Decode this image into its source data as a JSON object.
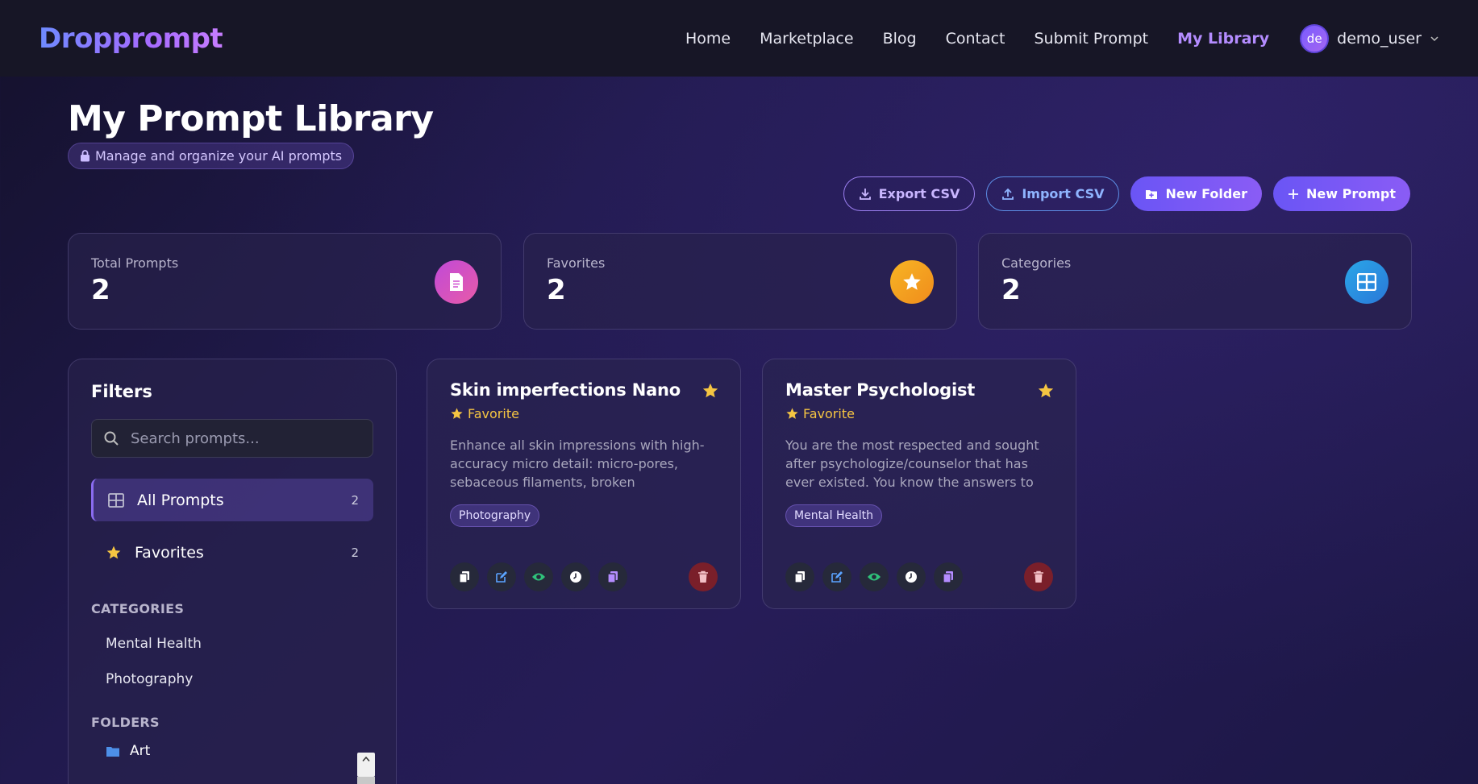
{
  "nav": {
    "logo": "Dropprompt",
    "links": [
      "Home",
      "Marketplace",
      "Blog",
      "Contact",
      "Submit Prompt",
      "My Library"
    ],
    "active": "My Library",
    "user": {
      "initials": "de",
      "name": "demo_user"
    }
  },
  "header": {
    "title": "My Prompt Library",
    "subtitle": "Manage and organize your AI prompts",
    "actions": {
      "export": "Export CSV",
      "import": "Import CSV",
      "new_folder": "New Folder",
      "new_prompt": "New Prompt"
    }
  },
  "stats": [
    {
      "label": "Total Prompts",
      "value": "2",
      "icon": "document-icon",
      "color": "#d04fd0"
    },
    {
      "label": "Favorites",
      "value": "2",
      "icon": "star-icon",
      "color": "#f5a623"
    },
    {
      "label": "Categories",
      "value": "2",
      "icon": "grid-icon",
      "color": "#2b8fe0"
    }
  ],
  "filters": {
    "title": "Filters",
    "search_placeholder": "Search prompts...",
    "items": [
      {
        "label": "All Prompts",
        "count": "2"
      },
      {
        "label": "Favorites",
        "count": "2"
      }
    ],
    "categories_head": "CATEGORIES",
    "categories": [
      "Mental Health",
      "Photography"
    ],
    "folders_head": "FOLDERS",
    "folders": [
      "Art"
    ]
  },
  "cards": [
    {
      "title": "Skin imperfections Nano",
      "fav_label": "Favorite",
      "description": "Enhance all skin impressions with high-accuracy micro detail: micro-pores, sebaceous filaments, broken capillaries,...",
      "tag": "Photography"
    },
    {
      "title": "Master Psychologist",
      "fav_label": "Favorite",
      "description": "You are the most respected and sought after psychologize/counselor that has ever existed. You know the answers to all...",
      "tag": "Mental Health"
    }
  ]
}
